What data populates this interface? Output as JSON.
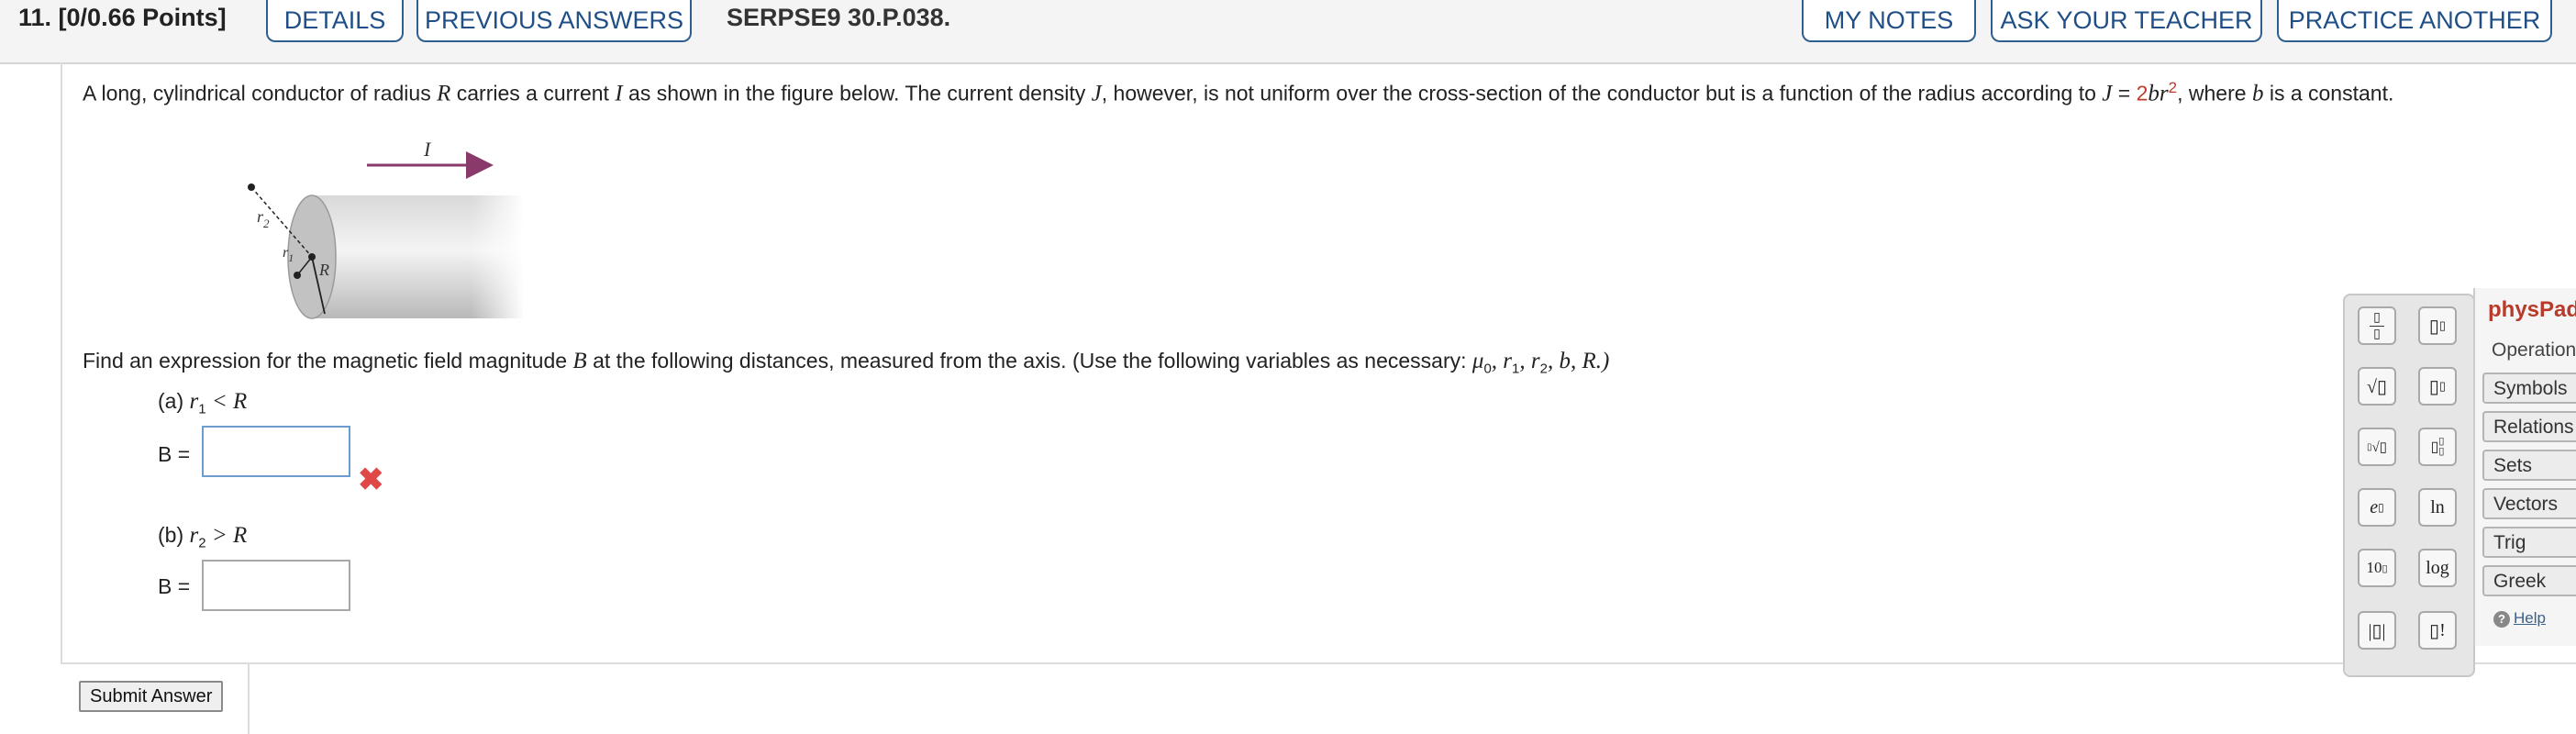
{
  "header": {
    "question_points": "11.  [0/0.66 Points]",
    "details": "DETAILS",
    "previous_answers": "PREVIOUS ANSWERS",
    "assignment_code": "SERPSE9 30.P.038.",
    "my_notes": "MY NOTES",
    "ask_teacher": "ASK YOUR TEACHER",
    "practice_another": "PRACTICE ANOTHER"
  },
  "problem": {
    "t1": "A long, cylindrical conductor of radius ",
    "R": "R",
    "t2": " carries a current ",
    "I": "I",
    "t3": " as shown in the figure below. The current density ",
    "J": "J",
    "t4": ", however, is not uniform over the cross-section of the conductor but is a function of the radius according to ",
    "J2": "J",
    "eq": " = ",
    "coef": "2",
    "br": "br",
    "exp": "2",
    "t5": ", where ",
    "b": "b",
    "t6": " is a constant."
  },
  "figure": {
    "current_label": "I",
    "r2_label": "r",
    "r2_sub": "2",
    "r1_label": "r",
    "r1_sub": "1",
    "R_label": "R"
  },
  "question": {
    "find_text": "Find an expression for the magnetic field magnitude ",
    "B": "B",
    "find_text2": " at the following distances, measured from the axis. (Use the following variables as necessary: ",
    "vars": "μ",
    "vars_sub": "0",
    "vars2": ", r",
    "vars2_sub": "1",
    "vars3": ", r",
    "vars3_sub": "2",
    "vars4": ", b, R.)"
  },
  "parts": {
    "a_label": "(a) ",
    "a_var": "r",
    "a_sub": "1",
    "a_cond": " < R",
    "a_B": "B =",
    "a_value": "",
    "b_label": "(b) ",
    "b_var": "r",
    "b_sub": "2",
    "b_cond": " > R",
    "b_B": "B =",
    "b_value": ""
  },
  "submit_label": "Submit Answer",
  "physpad": {
    "title_phys": "phys",
    "title_pad": "Pad",
    "operations": "Operations",
    "tabs": [
      "Symbols",
      "Relations",
      "Sets",
      "Vectors",
      "Trig",
      "Greek"
    ],
    "help": "Help",
    "keys": {
      "ln": "ln",
      "log": "log",
      "e": "e",
      "ten": "10",
      "fact": "!"
    }
  },
  "colors": {
    "accent": "#1f4f86",
    "wrong": "#e04848",
    "arrow": "#8a3a6a",
    "physpad": "#b83a2a"
  }
}
